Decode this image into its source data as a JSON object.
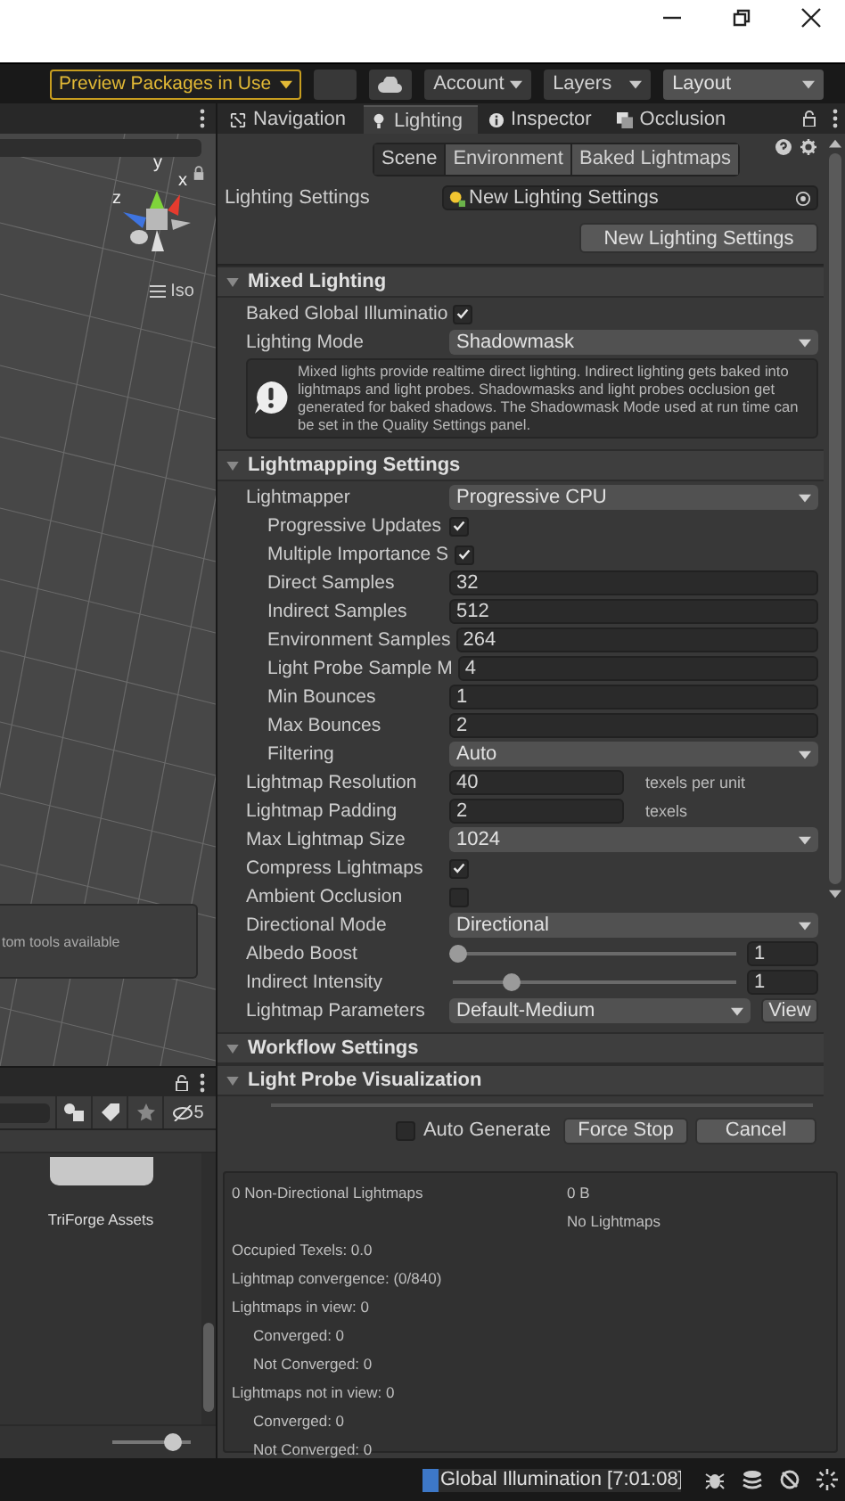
{
  "toolbar": {
    "packages_button": "Preview Packages in Use",
    "dropdowns": [
      "Account",
      "Layers",
      "Layout"
    ]
  },
  "scene_view": {
    "axes": [
      "y",
      "x",
      "z"
    ],
    "projection": "Iso",
    "overlay_text": "tom tools available"
  },
  "project": {
    "hidden_count": "5",
    "item_label": "TriForge Assets",
    "zoom": {
      "level": 0.85
    }
  },
  "tabs": [
    {
      "label": "Navigation",
      "selected": false
    },
    {
      "label": "Lighting",
      "selected": true
    },
    {
      "label": "Inspector",
      "selected": false
    },
    {
      "label": "Occlusion",
      "selected": false
    }
  ],
  "subtabs": [
    {
      "label": "Scene",
      "selected": true
    },
    {
      "label": "Environment",
      "selected": false
    },
    {
      "label": "Baked Lightmaps",
      "selected": false
    }
  ],
  "lighting_settings": {
    "label": "Lighting Settings",
    "asset": "New Lighting Settings",
    "button": "New Lighting Settings"
  },
  "sections": [
    {
      "title": "Mixed Lighting",
      "rows": [
        {
          "kind": "checkbox",
          "label": "Baked Global Illuminatio",
          "checked": true
        },
        {
          "kind": "dropdown",
          "label": "Lighting Mode",
          "value": "Shadowmask"
        },
        {
          "kind": "help",
          "text": "Mixed lights provide realtime direct lighting. Indirect lighting gets baked into lightmaps and light probes. Shadowmasks and light probes occlusion get generated for baked shadows. The Shadowmask Mode used at run time can be set in the Quality Settings panel."
        }
      ]
    },
    {
      "title": "Lightmapping Settings",
      "rows": [
        {
          "kind": "dropdown",
          "label": "Lightmapper",
          "value": "Progressive CPU",
          "children": [
            {
              "kind": "checkbox",
              "label": "Progressive Updates",
              "checked": true
            },
            {
              "kind": "checkbox",
              "label": "Multiple Importance S",
              "checked": true
            },
            {
              "kind": "field",
              "label": "Direct Samples",
              "value": "32"
            },
            {
              "kind": "field",
              "label": "Indirect Samples",
              "value": "512"
            },
            {
              "kind": "field",
              "label": "Environment Samples",
              "value": "264"
            },
            {
              "kind": "field",
              "label": "Light Probe Sample M",
              "value": "4"
            },
            {
              "kind": "field",
              "label": "Min Bounces",
              "value": "1"
            },
            {
              "kind": "field",
              "label": "Max Bounces",
              "value": "2"
            },
            {
              "kind": "dropdown",
              "label": "Filtering",
              "value": "Auto"
            }
          ]
        },
        {
          "kind": "field_unit",
          "label": "Lightmap Resolution",
          "value": "40",
          "unit": "texels per unit"
        },
        {
          "kind": "field_unit",
          "label": "Lightmap Padding",
          "value": "2",
          "unit": "texels"
        },
        {
          "kind": "dropdown",
          "label": "Max Lightmap Size",
          "value": "1024"
        },
        {
          "kind": "checkbox",
          "label": "Compress Lightmaps",
          "checked": true
        },
        {
          "kind": "checkbox",
          "label": "Ambient Occlusion",
          "checked": false
        },
        {
          "kind": "dropdown",
          "label": "Directional Mode",
          "value": "Directional"
        },
        {
          "kind": "slider",
          "label": "Albedo Boost",
          "level": 0,
          "value": "1"
        },
        {
          "kind": "slider",
          "label": "Indirect Intensity",
          "level": 0.2,
          "value": "1"
        },
        {
          "kind": "dropdown_button",
          "label": "Lightmap Parameters",
          "value": "Default-Medium",
          "button": "View"
        }
      ]
    },
    {
      "title": "Workflow Settings"
    },
    {
      "title": "Light Probe Visualization"
    }
  ],
  "bake": {
    "auto_generate": {
      "label": "Auto Generate",
      "checked": false
    },
    "buttons": [
      "Force Stop",
      "Cancel"
    ]
  },
  "stats": {
    "left": [
      {
        "text": "0 Non-Directional Lightmaps"
      },
      {
        "text": "Occupied Texels: 0.0"
      },
      {
        "text": "Lightmap convergence: (0/840)"
      },
      {
        "text": "Lightmaps in view: 0",
        "children": [
          {
            "text": "Converged: 0"
          },
          {
            "text": "Not Converged: 0"
          }
        ]
      },
      {
        "text": "Lightmaps not in view: 0",
        "children": [
          {
            "text": "Converged: 0"
          },
          {
            "text": "Not Converged: 0"
          }
        ]
      }
    ],
    "right": [
      "0 B",
      "No Lightmaps"
    ]
  },
  "status": {
    "text": "Global Illumination [7:01:08]",
    "level": 0.06
  }
}
